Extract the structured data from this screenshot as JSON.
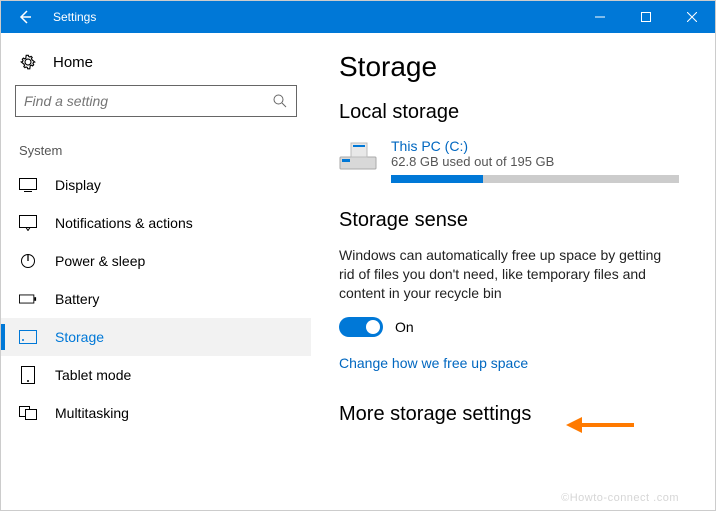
{
  "titlebar": {
    "title": "Settings"
  },
  "sidebar": {
    "home_label": "Home",
    "search_placeholder": "Find a setting",
    "section_label": "System",
    "items": [
      {
        "label": "Display"
      },
      {
        "label": "Notifications & actions"
      },
      {
        "label": "Power & sleep"
      },
      {
        "label": "Battery"
      },
      {
        "label": "Storage"
      },
      {
        "label": "Tablet mode"
      },
      {
        "label": "Multitasking"
      }
    ]
  },
  "main": {
    "heading": "Storage",
    "local_storage_heading": "Local storage",
    "drive": {
      "name": "This PC (C:)",
      "usage_text": "62.8 GB used out of 195 GB",
      "used_gb": 62.8,
      "total_gb": 195,
      "fill_percent": 32
    },
    "storage_sense_heading": "Storage sense",
    "storage_sense_desc": "Windows can automatically free up space by getting rid of files you don't need, like temporary files and content in your recycle bin",
    "toggle_state": "On",
    "change_link": "Change how we free up space",
    "more_heading": "More storage settings"
  },
  "watermark": "©Howto-connect .com",
  "colors": {
    "accent": "#0078d7",
    "link": "#0067c0"
  }
}
